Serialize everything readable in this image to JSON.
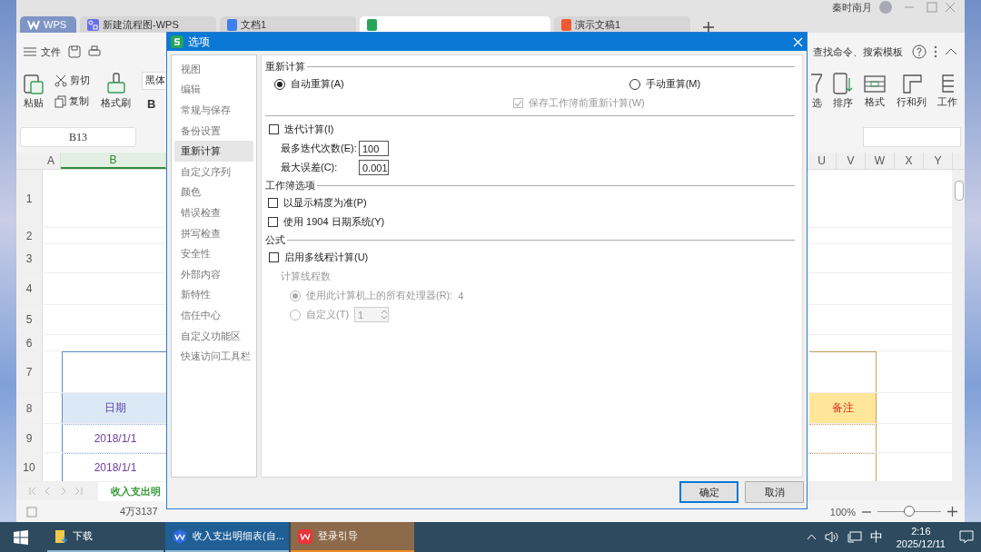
{
  "app_window": {
    "user": "秦时南月",
    "tabs": [
      {
        "label": "WPS",
        "kind": "home",
        "selected": false
      },
      {
        "label": "新建流程图-WPS",
        "kind": "flow",
        "selected": false
      },
      {
        "label": "文档1",
        "kind": "writer",
        "selected": false
      },
      {
        "kind": "sheet",
        "selected": true
      },
      {
        "label": "演示文稿1",
        "kind": "slides",
        "selected": false
      }
    ],
    "file_menu": "文件",
    "search": "查找命令、搜索模板",
    "ribbon_left": [
      {
        "label": "粘贴",
        "kind": "paste"
      },
      {
        "label": "剪切",
        "kind": "cut"
      },
      {
        "label": "复制",
        "kind": "copy"
      },
      {
        "label": "格式刷",
        "kind": "brush"
      }
    ],
    "font": "黑体",
    "bold": "B",
    "ribbon_right": [
      {
        "label": "选",
        "kind": "filter"
      },
      {
        "label": "排序",
        "kind": "sort"
      },
      {
        "label": "格式",
        "kind": "format"
      },
      {
        "label": "行和列",
        "kind": "rowcol"
      },
      {
        "label": "工作",
        "kind": "sheet"
      }
    ],
    "name_box": "B13",
    "columns_left": [
      "A",
      "B"
    ],
    "columns_right": [
      "U",
      "V",
      "W",
      "X",
      "Y"
    ],
    "rows": [
      {
        "number": "1",
        "kind": "blank"
      },
      {
        "number": "2",
        "kind": "blank"
      },
      {
        "number": "3",
        "kind": "blank"
      },
      {
        "number": "4",
        "kind": "blank"
      },
      {
        "number": "5",
        "kind": "blank"
      },
      {
        "number": "6",
        "kind": "blank"
      },
      {
        "number": "7",
        "kind": "title"
      },
      {
        "number": "8",
        "kind": "header",
        "date": "日期",
        "note": "备注"
      },
      {
        "number": "9",
        "kind": "data",
        "date": "2018/1/1"
      },
      {
        "number": "10",
        "kind": "data",
        "date": "2018/1/1"
      }
    ],
    "sheet_tab": "收入支出明",
    "status": "4万3137",
    "zoom": "100%",
    "zoom_slider": {
      "level": 0.5
    }
  },
  "dialog": {
    "title": "选项",
    "nav": [
      {
        "label": "视图",
        "selected": false
      },
      {
        "label": "编辑",
        "selected": false
      },
      {
        "label": "常规与保存",
        "selected": false
      },
      {
        "label": "备份设置",
        "selected": false
      },
      {
        "label": "重新计算",
        "selected": true
      },
      {
        "label": "自定义序列",
        "selected": false
      },
      {
        "label": "颜色",
        "selected": false
      },
      {
        "label": "错误检查",
        "selected": false
      },
      {
        "label": "拼写检查",
        "selected": false
      },
      {
        "label": "安全性",
        "selected": false
      },
      {
        "label": "外部内容",
        "selected": false
      },
      {
        "label": "新特性",
        "selected": false
      },
      {
        "label": "信任中心",
        "selected": false
      },
      {
        "label": "自定义功能区",
        "selected": false
      },
      {
        "label": "快速访问工具栏",
        "selected": false
      }
    ],
    "recalc": {
      "heading": "重新计算",
      "auto": {
        "label": "自动重算(A)",
        "selected": true
      },
      "manual": {
        "label": "手动重算(M)",
        "selected": false
      },
      "save_before": {
        "label": "保存工作簿前重新计算(W)",
        "checked": true,
        "disabled": true
      }
    },
    "iteration": {
      "label": "迭代计算(I)",
      "checked": false,
      "max_count": {
        "label": "最多迭代次数(E):",
        "value": "100"
      },
      "max_change": {
        "label": "最大误差(C):",
        "value": "0.001"
      }
    },
    "workbook": {
      "heading": "工作簿选项",
      "options": [
        {
          "label": "以显示精度为准(P)",
          "checked": false
        },
        {
          "label": "使用 1904 日期系统(Y)",
          "checked": false
        }
      ]
    },
    "formula": {
      "heading": "公式",
      "multithread": {
        "label": "启用多线程计算(U)",
        "checked": false
      },
      "threads_heading": "计算线程数",
      "all_processors": {
        "label": "使用此计算机上的所有处理器(R):",
        "count": "4",
        "selected": true,
        "disabled": true
      },
      "custom": {
        "label": "自定义(T)",
        "value": "1",
        "selected": false,
        "disabled": true
      }
    },
    "buttons": [
      {
        "label": "确定",
        "kind": "default"
      },
      {
        "label": "取消",
        "kind": "normal"
      }
    ]
  },
  "taskbar": {
    "items": [
      {
        "label": "下载",
        "kind": "folder",
        "selected": false
      },
      {
        "label": "收入支出明细表(自...",
        "kind": "wps",
        "selected": true
      },
      {
        "label": "登录引导",
        "kind": "login",
        "selected": false
      }
    ],
    "ime": "中",
    "time": "2:16",
    "date": "2025/12/11"
  }
}
